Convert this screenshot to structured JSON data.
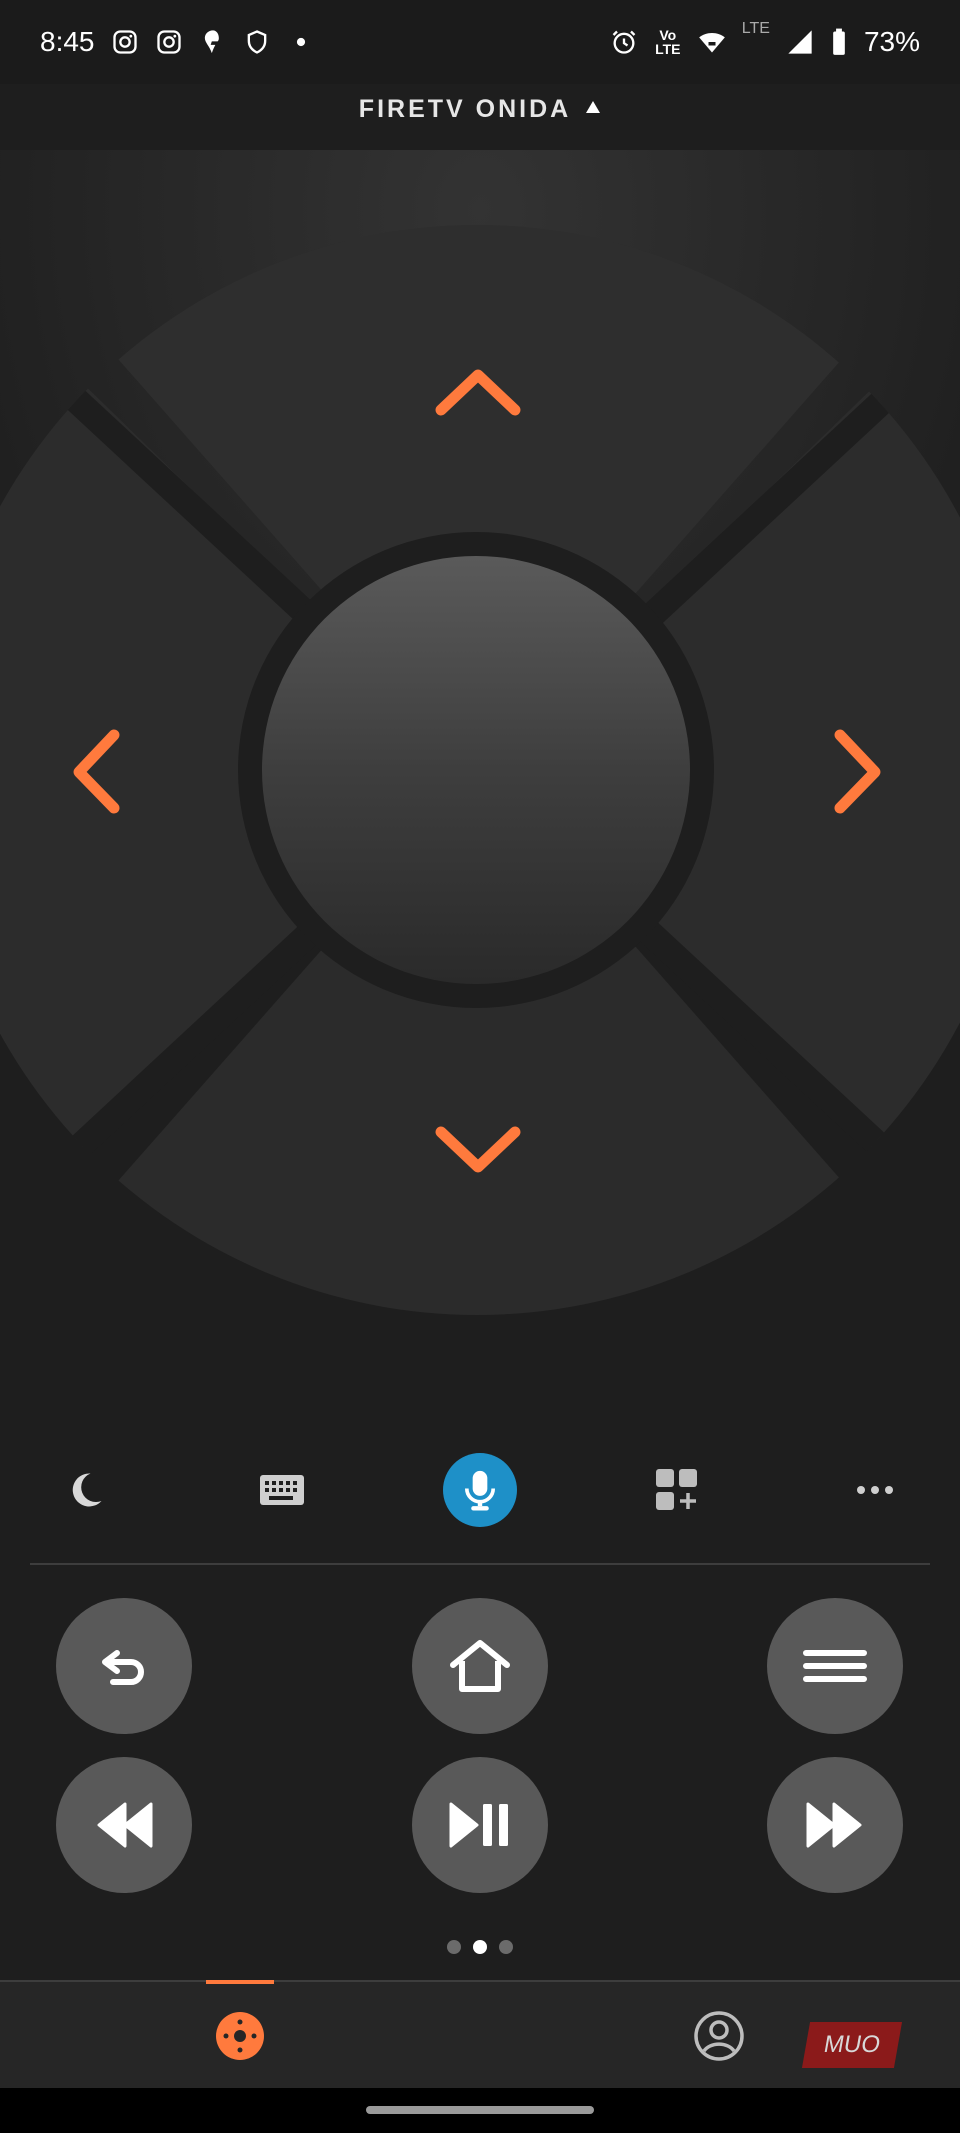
{
  "status_bar": {
    "time": "8:45",
    "volte_top": "Vo",
    "volte_bottom": "LTE",
    "lte_label": "LTE",
    "battery": "73%",
    "icons": [
      "instagram-icon",
      "instagram-icon",
      "swiggy-icon",
      "shield-icon",
      "dot-icon",
      "alarm-icon",
      "volte-icon",
      "wifi-icon",
      "lte-signal-icon",
      "battery-icon"
    ]
  },
  "device": {
    "name": "FIRETV ONIDA",
    "dropdown_icon": "caret-up-icon"
  },
  "dpad": {
    "accent_color": "#ff7a3d",
    "up_icon": "chevron-up-icon",
    "down_icon": "chevron-down-icon",
    "left_icon": "chevron-left-icon",
    "right_icon": "chevron-right-icon",
    "center": "select-button"
  },
  "toolbar": {
    "items": [
      "sleep-icon",
      "keyboard-icon",
      "microphone-icon",
      "apps-icon",
      "more-icon"
    ],
    "mic_color": "#1e90c8"
  },
  "controls": {
    "row1": [
      "back-icon",
      "home-icon",
      "menu-icon"
    ],
    "row2": [
      "rewind-icon",
      "play-pause-icon",
      "fast-forward-icon"
    ]
  },
  "pager": {
    "count": 3,
    "active": 2
  },
  "bottom_nav": {
    "items": [
      "remote-icon",
      "profile-icon"
    ],
    "active": "remote-icon"
  },
  "watermark": {
    "text": "MUO"
  }
}
